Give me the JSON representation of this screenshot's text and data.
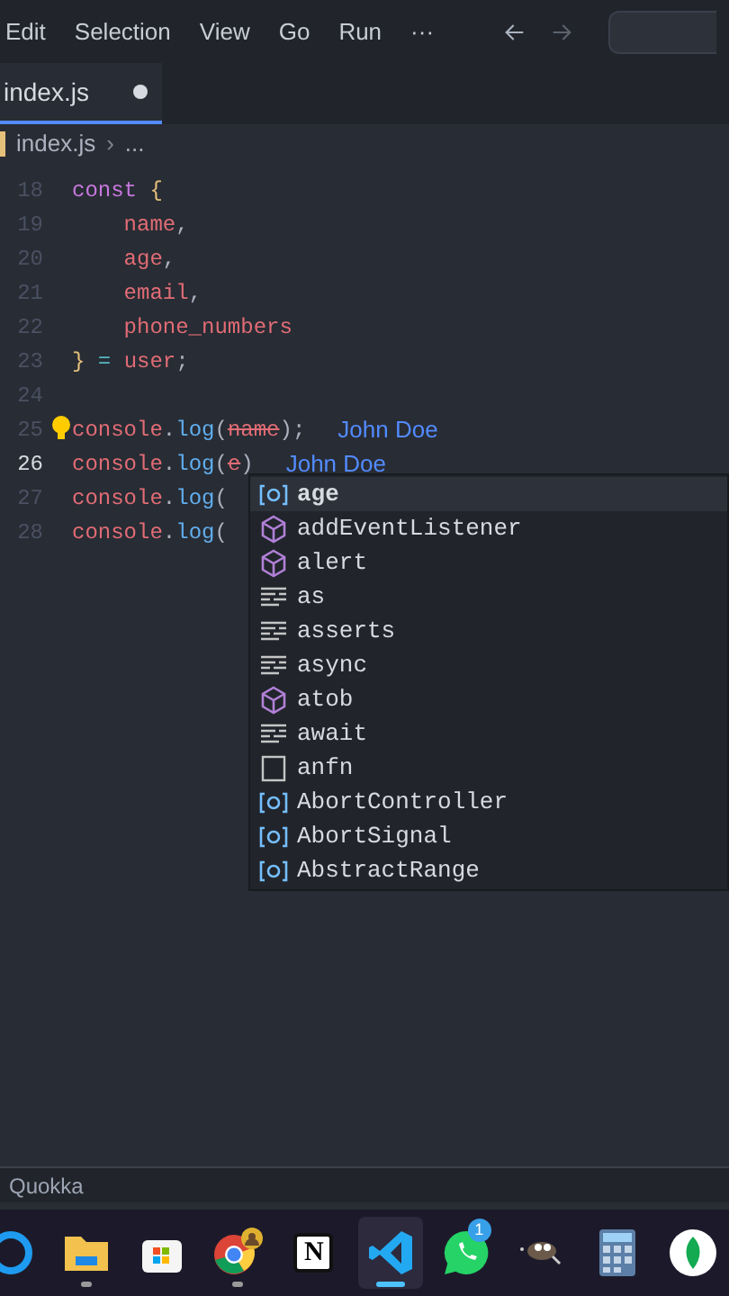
{
  "menu": [
    "Edit",
    "Selection",
    "View",
    "Go",
    "Run",
    "···"
  ],
  "nav": [
    {
      "kind": "back",
      "disabled": false
    },
    {
      "kind": "forward",
      "disabled": true
    }
  ],
  "tab": {
    "label": "index.js",
    "dirty": true,
    "selected": true
  },
  "breadcrumb": {
    "items": [
      "index.js",
      "..."
    ],
    "separator": "›"
  },
  "lines": [
    {
      "number": "18",
      "current": false,
      "lightbulb": false,
      "tokens": [
        {
          "text": "const",
          "kind": "keyword"
        },
        {
          "text": " {",
          "kind": "brace"
        }
      ]
    },
    {
      "number": "19",
      "current": false,
      "lightbulb": false,
      "tokens": [
        {
          "text": "    name",
          "kind": "variable"
        },
        {
          "text": ",",
          "kind": "punct"
        }
      ]
    },
    {
      "number": "20",
      "current": false,
      "lightbulb": false,
      "tokens": [
        {
          "text": "    age",
          "kind": "variable"
        },
        {
          "text": ",",
          "kind": "punct"
        }
      ]
    },
    {
      "number": "21",
      "current": false,
      "lightbulb": false,
      "tokens": [
        {
          "text": "    email",
          "kind": "variable"
        },
        {
          "text": ",",
          "kind": "punct"
        }
      ]
    },
    {
      "number": "22",
      "current": false,
      "lightbulb": false,
      "tokens": [
        {
          "text": "    phone_numbers",
          "kind": "variable"
        }
      ]
    },
    {
      "number": "23",
      "current": false,
      "lightbulb": false,
      "tokens": [
        {
          "text": "}",
          "kind": "brace"
        },
        {
          "text": " = ",
          "kind": "operator"
        },
        {
          "text": "user",
          "kind": "variable"
        },
        {
          "text": ";",
          "kind": "punct"
        }
      ]
    },
    {
      "number": "24",
      "current": false,
      "lightbulb": false
    },
    {
      "number": "25",
      "current": false,
      "lightbulb": true,
      "tokens": [
        {
          "text": "console",
          "kind": "variable"
        },
        {
          "text": ".",
          "kind": "punct"
        },
        {
          "text": "log",
          "kind": "function"
        },
        {
          "text": "(",
          "kind": "punct"
        },
        {
          "text": "name",
          "kind": "deprecated"
        },
        {
          "text": ");",
          "kind": "punct"
        },
        {
          "text": "John Doe",
          "kind": "hint"
        }
      ]
    },
    {
      "number": "26",
      "current": true,
      "lightbulb": false,
      "tokens": [
        {
          "text": "console",
          "kind": "variable"
        },
        {
          "text": ".",
          "kind": "punct"
        },
        {
          "text": "log",
          "kind": "function"
        },
        {
          "text": "(",
          "kind": "punct"
        },
        {
          "text": "e",
          "kind": "deprecated"
        },
        {
          "text": ")",
          "kind": "punct"
        },
        {
          "text": "John Doe",
          "kind": "hint"
        }
      ]
    },
    {
      "number": "27",
      "current": false,
      "lightbulb": false,
      "tokens": [
        {
          "text": "console",
          "kind": "variable"
        },
        {
          "text": ".",
          "kind": "punct"
        },
        {
          "text": "log",
          "kind": "function"
        },
        {
          "text": "(",
          "kind": "punct"
        }
      ]
    },
    {
      "number": "28",
      "current": false,
      "lightbulb": false,
      "tokens": [
        {
          "text": "console",
          "kind": "variable"
        },
        {
          "text": ".",
          "kind": "punct"
        },
        {
          "text": "log",
          "kind": "function"
        },
        {
          "text": "(",
          "kind": "punct"
        }
      ]
    }
  ],
  "suggestions": [
    {
      "label": "age",
      "kind": "variable",
      "selected": true
    },
    {
      "label": "addEventListener",
      "kind": "method",
      "selected": false
    },
    {
      "label": "alert",
      "kind": "method",
      "selected": false
    },
    {
      "label": "as",
      "kind": "keyword",
      "selected": false
    },
    {
      "label": "asserts",
      "kind": "keyword",
      "selected": false
    },
    {
      "label": "async",
      "kind": "keyword",
      "selected": false
    },
    {
      "label": "atob",
      "kind": "method",
      "selected": false
    },
    {
      "label": "await",
      "kind": "keyword",
      "selected": false
    },
    {
      "label": "anfn",
      "kind": "snippet",
      "selected": false
    },
    {
      "label": "AbortController",
      "kind": "variable",
      "selected": false
    },
    {
      "label": "AbortSignal",
      "kind": "variable",
      "selected": false
    },
    {
      "label": "AbstractRange",
      "kind": "variable",
      "selected": false
    }
  ],
  "status_bar": {
    "label": "Quokka"
  },
  "taskbar": [
    {
      "kind": "ring",
      "active": false,
      "running": false
    },
    {
      "kind": "folder",
      "active": false,
      "running": true
    },
    {
      "kind": "store",
      "active": false,
      "running": false
    },
    {
      "kind": "browser",
      "active": false,
      "running": true
    },
    {
      "kind": "notion",
      "label": "N",
      "active": false,
      "running": false
    },
    {
      "kind": "code",
      "active": true,
      "running": true
    },
    {
      "kind": "chat",
      "badge": "1",
      "active": false,
      "running": false
    },
    {
      "kind": "animal",
      "active": false,
      "running": false
    },
    {
      "kind": "calculator",
      "active": false,
      "running": false
    },
    {
      "kind": "leaf",
      "active": false,
      "running": false
    }
  ]
}
